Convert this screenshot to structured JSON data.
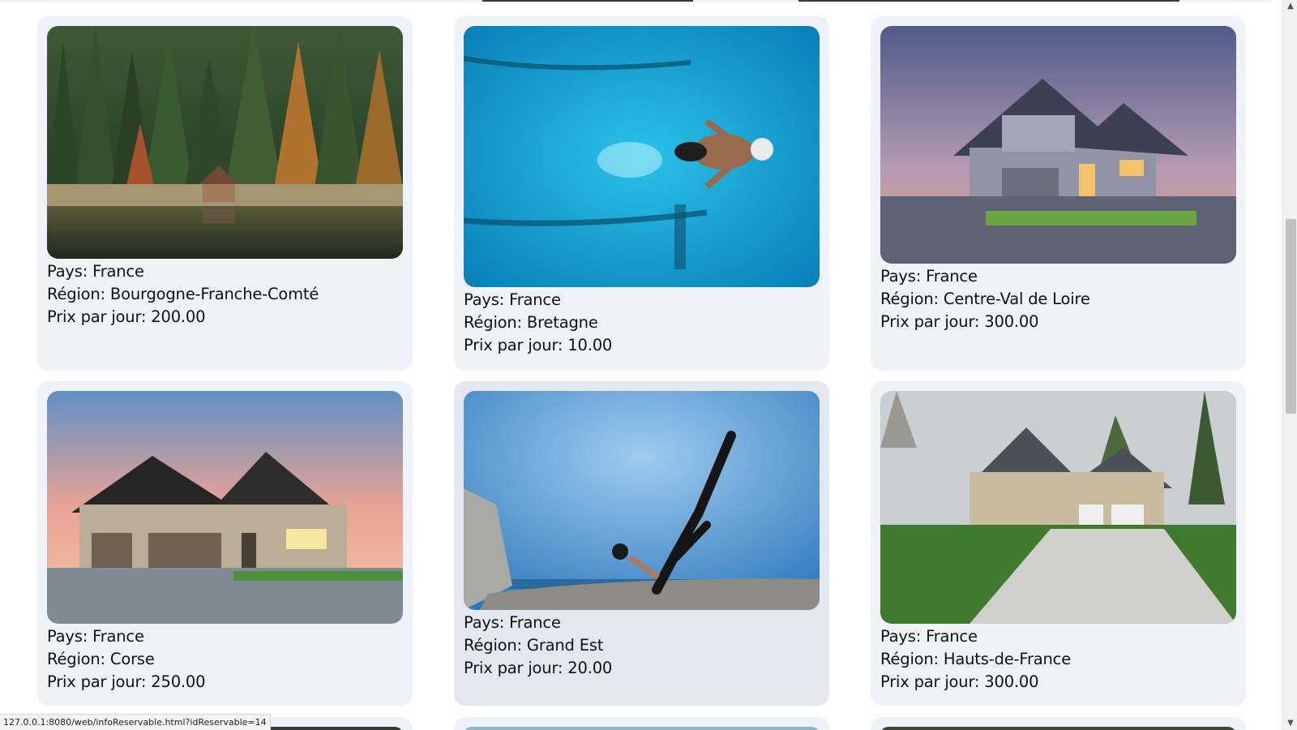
{
  "cards": [
    {
      "pays": "Pays: France",
      "region": "Région: Bourgogne-Franche-Comté",
      "prix": "Prix par jour: 200.00",
      "image": "lake-cabin-forest-photo"
    },
    {
      "pays": "Pays: France",
      "region": "Région: Bretagne",
      "prix": "Prix par jour: 10.00",
      "image": "swimmer-pool-photo"
    },
    {
      "pays": "Pays: France",
      "region": "Région: Centre-Val de Loire",
      "prix": "Prix par jour: 300.00",
      "image": "house-dusk-photo"
    },
    {
      "pays": "Pays: France",
      "region": "Région: Corse",
      "prix": "Prix par jour: 250.00",
      "image": "house-sunset-photo"
    },
    {
      "pays": "Pays: France",
      "region": "Région: Grand Est",
      "prix": "Prix par jour: 20.00",
      "image": "yoga-pose-photo"
    },
    {
      "pays": "Pays: France",
      "region": "Région: Hauts-de-France",
      "prix": "Prix par jour: 300.00",
      "image": "house-driveway-photo"
    }
  ],
  "statusbar": {
    "url": "127.0.0.1:8080/web/infoReservable.html?idReservable=14"
  },
  "colors": {
    "card_bg": "#eff3f9",
    "card_hover_bg": "#e3e8f0",
    "page_bg": "#ffffff"
  }
}
